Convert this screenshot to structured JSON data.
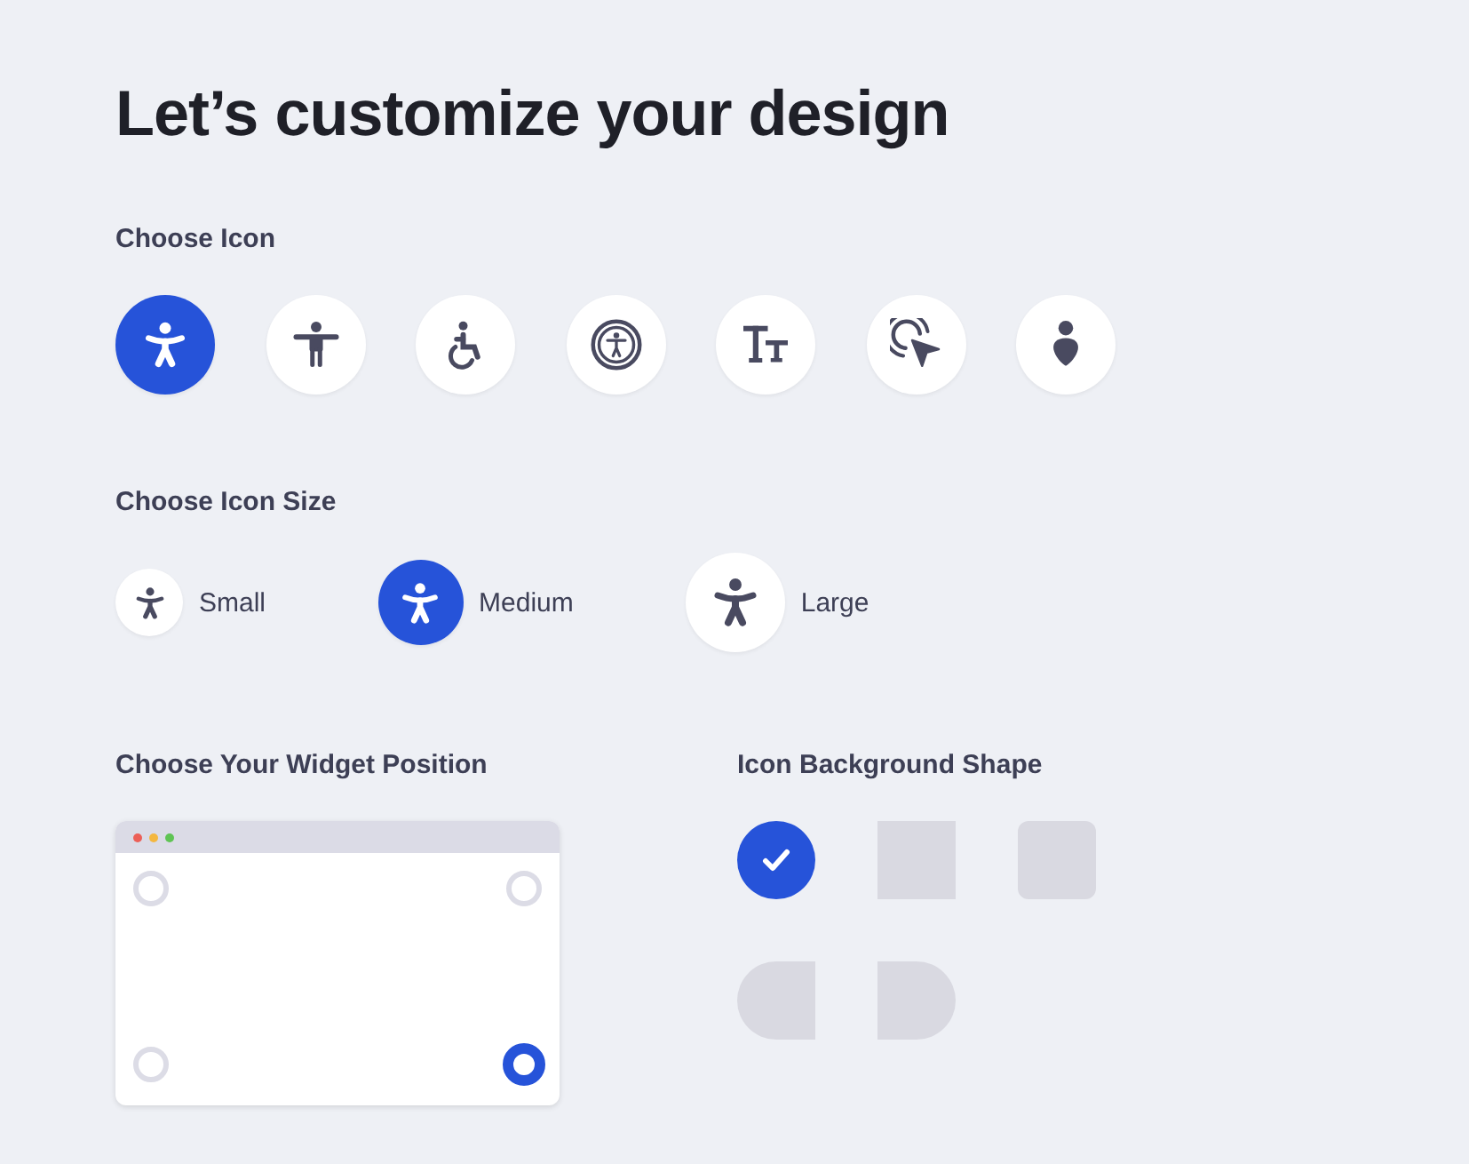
{
  "title": "Let’s customize your design",
  "icon_section": {
    "heading": "Choose Icon",
    "icons": [
      {
        "kind": "person-arms-up",
        "selected": true
      },
      {
        "kind": "person-arms-out",
        "selected": false
      },
      {
        "kind": "wheelchair",
        "selected": false
      },
      {
        "kind": "circled-person",
        "selected": false
      },
      {
        "kind": "text-size",
        "selected": false
      },
      {
        "kind": "cursor-click",
        "selected": false
      },
      {
        "kind": "person-silhouette",
        "selected": false
      }
    ]
  },
  "size_section": {
    "heading": "Choose Icon Size",
    "sizes": [
      {
        "kind": "small",
        "label": "Small",
        "selected": false
      },
      {
        "kind": "medium",
        "label": "Medium",
        "selected": true
      },
      {
        "kind": "large",
        "label": "Large",
        "selected": false
      }
    ]
  },
  "position_section": {
    "heading": "Choose Your Widget Position",
    "corners": [
      {
        "kind": "top-left",
        "selected": false
      },
      {
        "kind": "top-right",
        "selected": false
      },
      {
        "kind": "bottom-left",
        "selected": false
      },
      {
        "kind": "bottom-right",
        "selected": true
      }
    ]
  },
  "shape_section": {
    "heading": "Icon Background Shape",
    "shapes": [
      {
        "kind": "circle",
        "selected": true
      },
      {
        "kind": "square",
        "selected": false
      },
      {
        "kind": "rounded-square",
        "selected": false
      },
      {
        "kind": "left-rounded",
        "selected": false
      },
      {
        "kind": "right-rounded",
        "selected": false
      }
    ]
  }
}
